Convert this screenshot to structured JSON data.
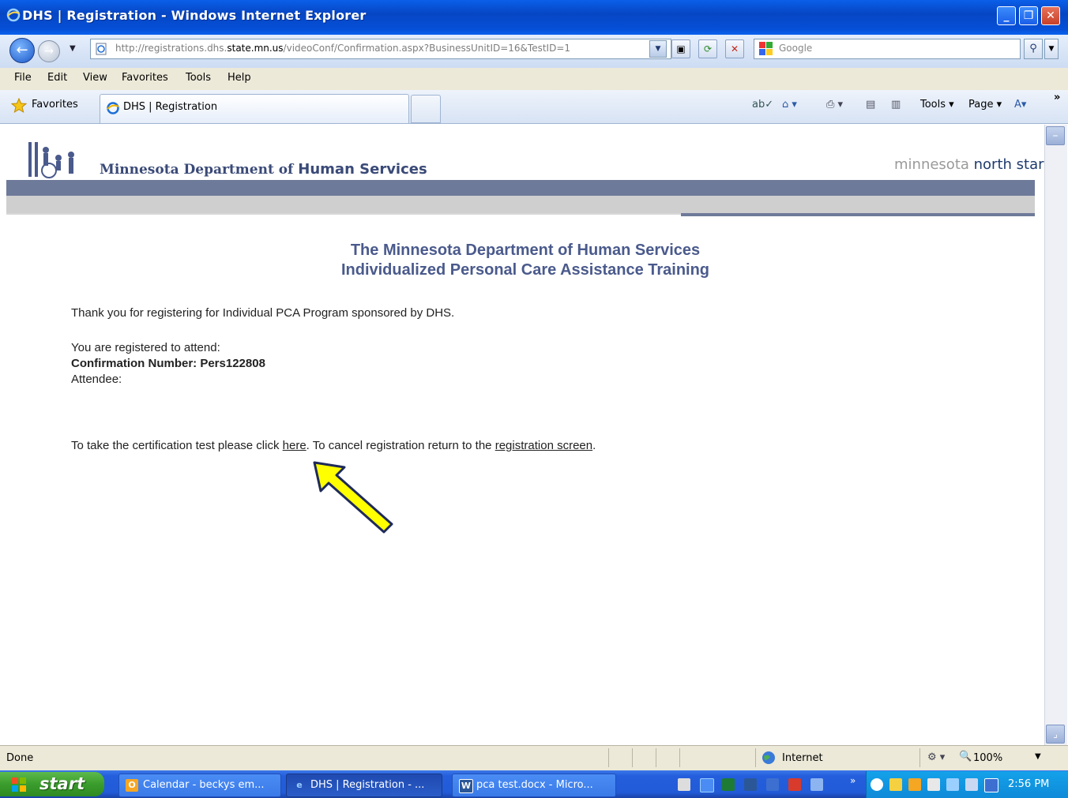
{
  "window": {
    "title": "DHS | Registration - Windows Internet Explorer",
    "controls": {
      "minimize": "_",
      "maximize": "❐",
      "close": "✕"
    }
  },
  "address_bar": {
    "url_prefix": "http://registrations.dhs.",
    "url_domain": "state.mn.us",
    "url_suffix": "/videoConf/Confirmation.aspx?BusinessUnitID=16&TestID=1"
  },
  "search": {
    "placeholder": "Google"
  },
  "menu": {
    "items": [
      "File",
      "Edit",
      "View",
      "Favorites",
      "Tools",
      "Help"
    ]
  },
  "favorites_bar": {
    "favorites_label": "Favorites",
    "tab_label": "DHS | Registration",
    "command_bar": {
      "page": "Page ▾",
      "tools": "Tools ▾"
    }
  },
  "page": {
    "dept_prefix": "Minnesota Department of ",
    "dept_bold": "Human Services",
    "northstar_light": "minnesota ",
    "northstar_bold": "north star)",
    "heading_line1": "The Minnesota Department of Human Services",
    "heading_line2": "Individualized Personal Care Assistance Training",
    "thank_you": "Thank you for registering for Individual PCA Program sponsored by DHS.",
    "registered": "You are registered to attend:",
    "confirmation": "Confirmation Number: Pers122808",
    "attendee": "Attendee:",
    "instruction_pre": "To take the certification test please click ",
    "here_link": "here",
    "instruction_mid": ". To cancel registration return to the ",
    "registration_link": "registration screen",
    "instruction_post": "."
  },
  "status_bar": {
    "status": "Done",
    "zone": "Internet",
    "zoom": "100%"
  },
  "taskbar": {
    "start": "start",
    "tasks": [
      {
        "label": "Calendar - beckys em...",
        "icon": "outlook-icon"
      },
      {
        "label": "DHS | Registration - ...",
        "icon": "ie-icon"
      },
      {
        "label": "pca test.docx - Micro...",
        "icon": "word-icon"
      }
    ],
    "clock": "2:56 PM"
  },
  "colors": {
    "heading": "#4a5a8c",
    "band_dark": "#6e7a99",
    "arrow": "#ffff00"
  }
}
